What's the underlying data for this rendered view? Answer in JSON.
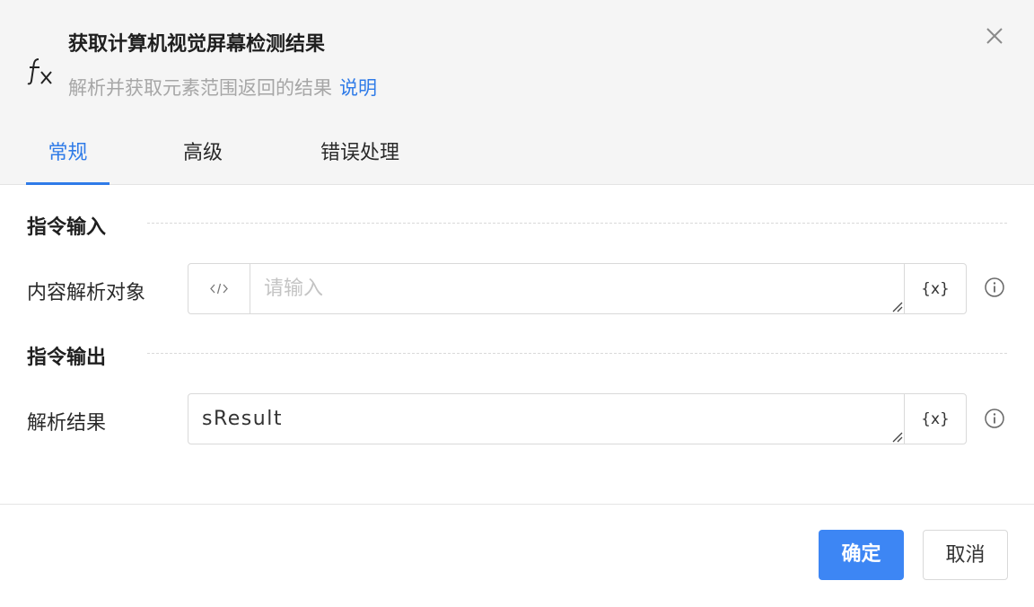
{
  "dialog": {
    "title": "获取计算机视觉屏幕检测结果",
    "subtitle": "解析并获取元素范围返回的结果",
    "help_link": "说明",
    "icon": "fx-icon"
  },
  "tabs": [
    {
      "label": "常规",
      "active": true
    },
    {
      "label": "高级",
      "active": false
    },
    {
      "label": "错误处理",
      "active": false
    }
  ],
  "sections": {
    "input": {
      "title": "指令输入",
      "field_label": "内容解析对象",
      "placeholder": "请输入",
      "value": ""
    },
    "output": {
      "title": "指令输出",
      "field_label": "解析结果",
      "value": "sResult"
    }
  },
  "buttons": {
    "confirm": "确定",
    "cancel": "取消",
    "variable": "{x}"
  },
  "colors": {
    "accent": "#2f7be8",
    "primary_button": "#3d86f4"
  }
}
